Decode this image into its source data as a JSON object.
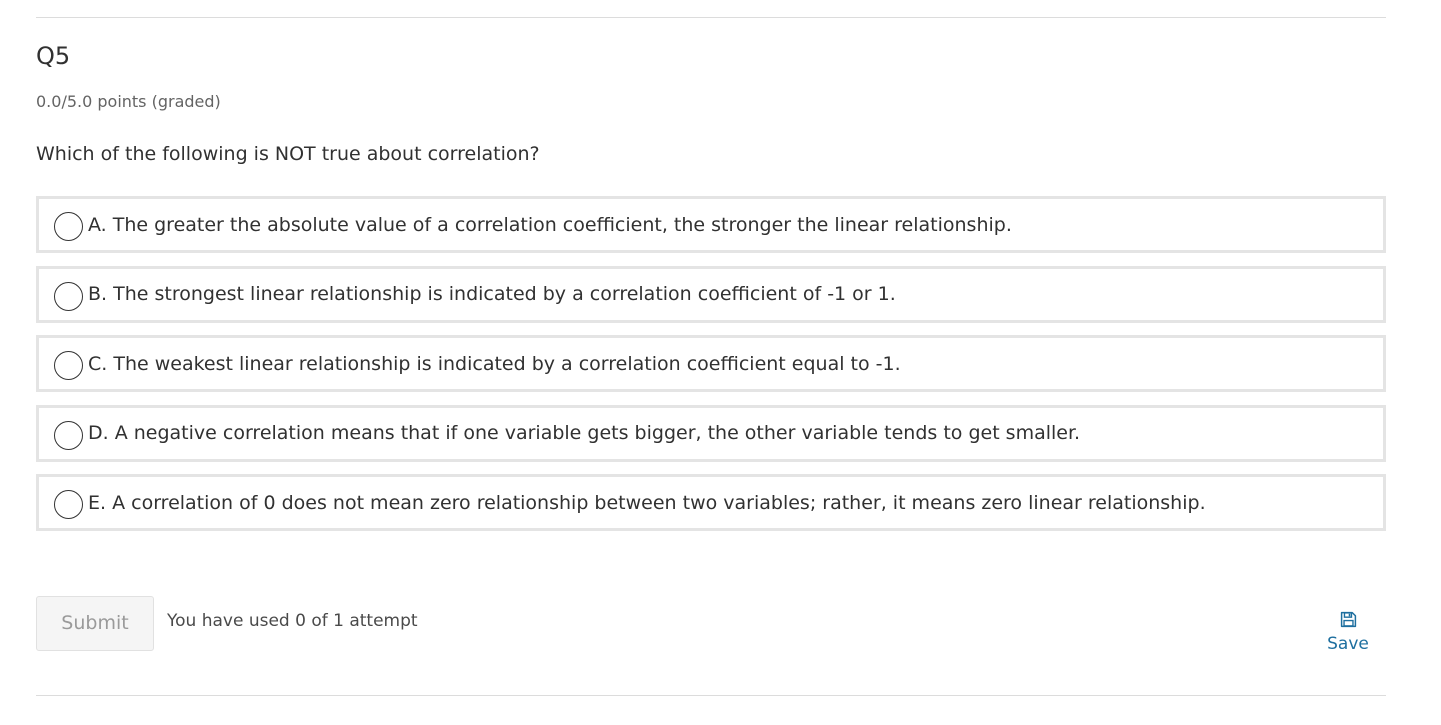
{
  "question": {
    "title": "Q5",
    "points": "0.0/5.0 points (graded)",
    "prompt": "Which of the following is NOT true about correlation?"
  },
  "choices": [
    {
      "label": "A. The greater the absolute value of a correlation coefficient, the stronger the linear relationship.",
      "selected": false
    },
    {
      "label": "B. The strongest linear relationship is indicated by a correlation coefficient of -1 or 1.",
      "selected": false
    },
    {
      "label": "C. The weakest linear relationship is indicated by a correlation coefficient equal to -1.",
      "selected": false
    },
    {
      "label": "D. A negative correlation means that if one variable gets bigger, the other variable tends to get smaller.",
      "selected": false
    },
    {
      "label": "E. A correlation of 0 does not mean zero relationship between two variables; rather, it means zero linear relationship.",
      "selected": false
    }
  ],
  "actions": {
    "submit_label": "Submit",
    "attempts_text": "You have used 0 of 1 attempt",
    "save_label": "Save",
    "save_icon": "floppy-disk-icon"
  },
  "colors": {
    "text": "#313131",
    "muted": "#646464",
    "choice_border": "#e4e4e4",
    "link": "#1e6f9f",
    "disabled_text": "#9a9a9a"
  }
}
